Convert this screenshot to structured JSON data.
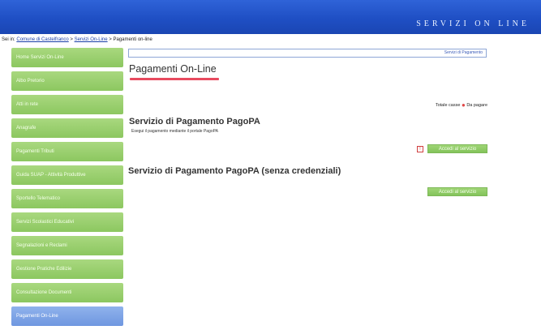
{
  "header": {
    "title": "SERVIZI ON LINE"
  },
  "breadcrumb": {
    "prefix": "Sei in:",
    "item1": "Comune di Castelfranco",
    "sep1": ">",
    "item2": "Servizi On-Line",
    "sep2": ">",
    "current": "Pagamenti on-line"
  },
  "sidebar": {
    "items": [
      {
        "label": "Home Servizi On-Line"
      },
      {
        "label": "Albo Pretorio"
      },
      {
        "label": "Atti in rete"
      },
      {
        "label": "Anagrafe"
      },
      {
        "label": "Pagamenti Tributi"
      },
      {
        "label": "Guida SUAP - Attività Produttive"
      },
      {
        "label": "Sportello Telematico"
      },
      {
        "label": "Servizi Scolastici Educativi"
      },
      {
        "label": "Segnalazioni e Reclami"
      },
      {
        "label": "Gestione Pratiche Edilizie"
      },
      {
        "label": "Consultazione Documenti"
      },
      {
        "label": "Pagamenti On-Line"
      }
    ]
  },
  "topbox": {
    "text": "Servizi di Pagamento"
  },
  "page": {
    "title": "Pagamenti On-Line"
  },
  "legend": {
    "prefix": "Totale casse",
    "suffix": "Da pagare"
  },
  "section1": {
    "title": "Servizio di Pagamento PagoPA",
    "description": "Esegui il pagamento mediante il portale PagoPA",
    "button": "Accedi al servizio"
  },
  "section2": {
    "title": "Servizio di Pagamento PagoPA (senza credenziali)",
    "button": "Accedi al servizio"
  }
}
